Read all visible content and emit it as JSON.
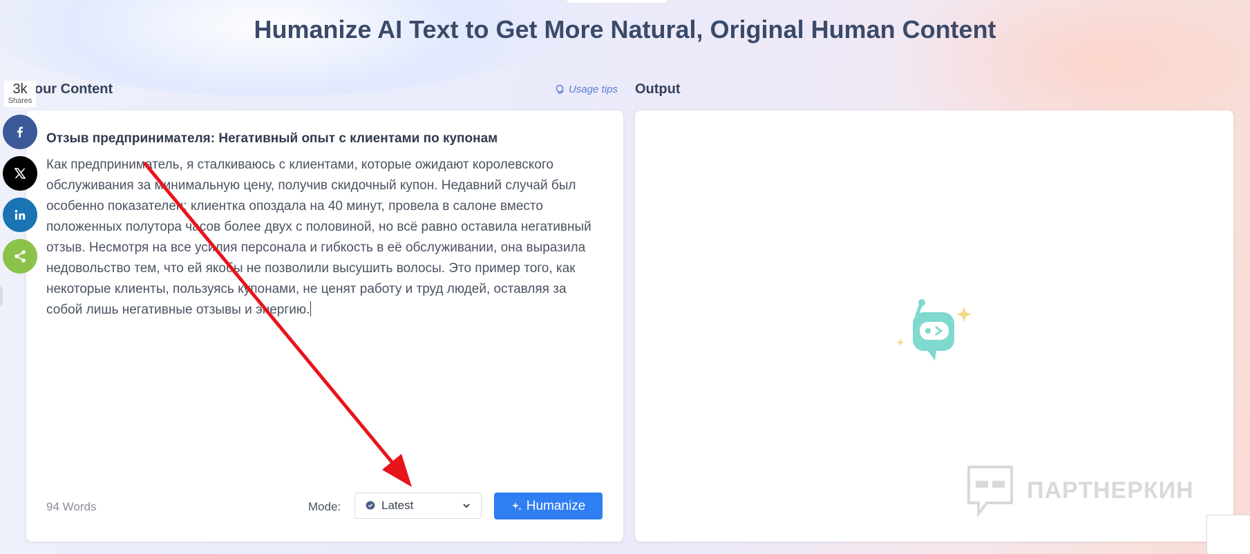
{
  "page": {
    "title": "Humanize AI Text to Get More Natural, Original Human Content"
  },
  "input": {
    "section_label": "Your Content",
    "usage_tips": "Usage tips",
    "content_title": "Отзыв предпринимателя: Негативный опыт с клиентами по купонам",
    "content_body": "Как предприниматель, я сталкиваюсь с клиентами, которые ожидают королевского обслуживания за минимальную цену, получив скидочный купон. Недавний случай был особенно показателен: клиентка опоздала на 40 минут, провела в салоне вместо положенных полутора часов более двух с половиной, но всё равно оставила негативный отзыв. Несмотря на все усилия персонала и гибкость в её обслуживании, она выразила недовольство тем, что ей якобы не позволили высушить волосы. Это пример того, как некоторые клиенты, пользуясь купонами, не ценят работу и труд людей, оставляя за собой лишь негативные отзывы и энергию.",
    "word_count": "94 Words",
    "mode_label": "Mode:",
    "mode_value": "Latest",
    "humanize_button": "Humanize"
  },
  "output": {
    "section_label": "Output",
    "watermark": "ПАРТНЕРКИН"
  },
  "share": {
    "count": "3k",
    "count_label": "Shares",
    "buttons": [
      "facebook-icon",
      "x-icon",
      "linkedin-icon",
      "share-icon"
    ]
  },
  "colors": {
    "accent": "#2f7ef2",
    "title": "#3b4a69",
    "facebook": "#3b5998",
    "x": "#000000",
    "linkedin": "#1a74b3",
    "share": "#8bc34a",
    "arrow": "#e8141b",
    "robot": "#7fd9cf"
  }
}
